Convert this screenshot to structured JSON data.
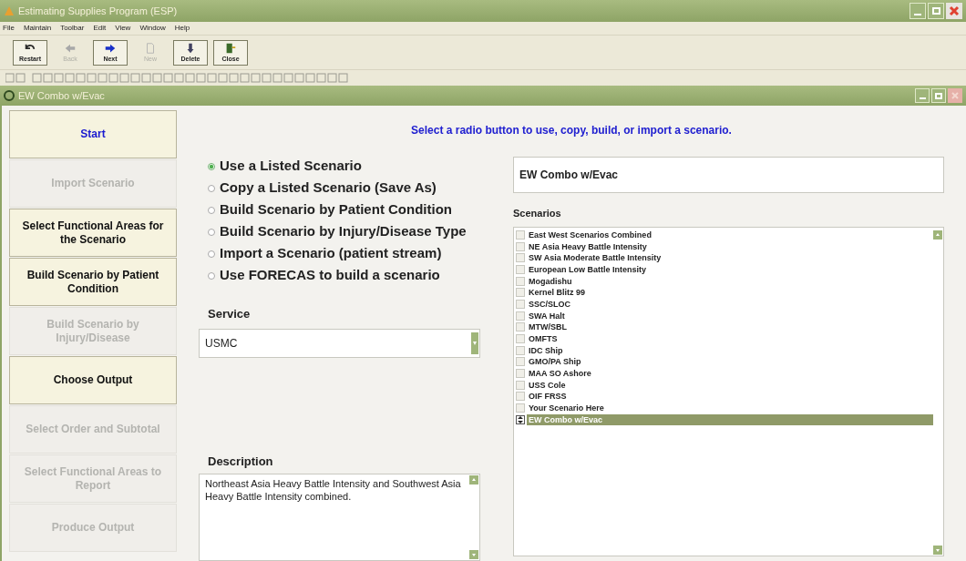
{
  "window": {
    "title": "Estimating Supplies Program (ESP)"
  },
  "menu": [
    "File",
    "Maintain",
    "Toolbar",
    "Edit",
    "View",
    "Window",
    "Help"
  ],
  "toolbar": [
    {
      "label": "Restart",
      "kind": "undo",
      "disabled": false
    },
    {
      "label": "Back",
      "kind": "back",
      "disabled": true
    },
    {
      "label": "Next",
      "kind": "next",
      "disabled": false
    },
    {
      "label": "New",
      "kind": "new",
      "disabled": true
    },
    {
      "label": "Delete",
      "kind": "delete",
      "disabled": false
    },
    {
      "label": "Close",
      "kind": "exit",
      "disabled": false
    }
  ],
  "child_window": {
    "title": "EW Combo w/Evac"
  },
  "nav": [
    {
      "label": "Start",
      "selected": true,
      "disabled": false
    },
    {
      "label": "Import Scenario",
      "selected": false,
      "disabled": true
    },
    {
      "label": "Select Functional Areas for the Scenario",
      "selected": false,
      "disabled": false
    },
    {
      "label": "Build Scenario by Patient Condition",
      "selected": false,
      "disabled": false
    },
    {
      "label": "Build Scenario by Injury/Disease",
      "selected": false,
      "disabled": true
    },
    {
      "label": "Choose Output",
      "selected": false,
      "disabled": false
    },
    {
      "label": "Select Order and Subtotal",
      "selected": false,
      "disabled": true
    },
    {
      "label": "Select Functional Areas to Report",
      "selected": false,
      "disabled": true
    },
    {
      "label": "Produce Output",
      "selected": false,
      "disabled": true
    }
  ],
  "instruction": "Select a radio button to use, copy, build, or import a scenario.",
  "options": [
    {
      "label": "Use a Listed Scenario",
      "selected": true
    },
    {
      "label": "Copy a Listed Scenario (Save As)",
      "selected": false
    },
    {
      "label": "Build Scenario by Patient Condition",
      "selected": false
    },
    {
      "label": "Build Scenario by Injury/Disease Type",
      "selected": false
    },
    {
      "label": "Import a Scenario (patient stream)",
      "selected": false
    },
    {
      "label": "Use FORECAS to build a scenario",
      "selected": false
    }
  ],
  "service": {
    "label": "Service",
    "value": "USMC"
  },
  "description": {
    "label": "Description",
    "value": "Northeast Asia Heavy Battle Intensity and Southwest Asia Heavy Battle Intensity combined."
  },
  "scenario_name": {
    "value": "EW Combo w/Evac"
  },
  "scenarios": {
    "label": "Scenarios",
    "items": [
      {
        "label": "East West Scenarios Combined",
        "selected": false,
        "checked": false
      },
      {
        "label": "NE Asia Heavy Battle Intensity",
        "selected": false,
        "checked": false
      },
      {
        "label": "SW Asia Moderate Battle Intensity",
        "selected": false,
        "checked": false
      },
      {
        "label": "European Low Battle Intensity",
        "selected": false,
        "checked": false
      },
      {
        "label": "Mogadishu",
        "selected": false,
        "checked": false
      },
      {
        "label": "Kernel Blitz 99",
        "selected": false,
        "checked": false
      },
      {
        "label": "SSC/SLOC",
        "selected": false,
        "checked": false
      },
      {
        "label": "SWA Halt",
        "selected": false,
        "checked": false
      },
      {
        "label": "MTW/SBL",
        "selected": false,
        "checked": false
      },
      {
        "label": "OMFTS",
        "selected": false,
        "checked": false
      },
      {
        "label": "IDC Ship",
        "selected": false,
        "checked": false
      },
      {
        "label": "GMO/PA Ship",
        "selected": false,
        "checked": false
      },
      {
        "label": "MAA SO Ashore",
        "selected": false,
        "checked": false
      },
      {
        "label": "USS Cole",
        "selected": false,
        "checked": false
      },
      {
        "label": "OIF FRSS",
        "selected": false,
        "checked": false
      },
      {
        "label": "Your Scenario Here",
        "selected": false,
        "checked": false
      },
      {
        "label": "EW Combo w/Evac",
        "selected": true
      }
    ]
  }
}
